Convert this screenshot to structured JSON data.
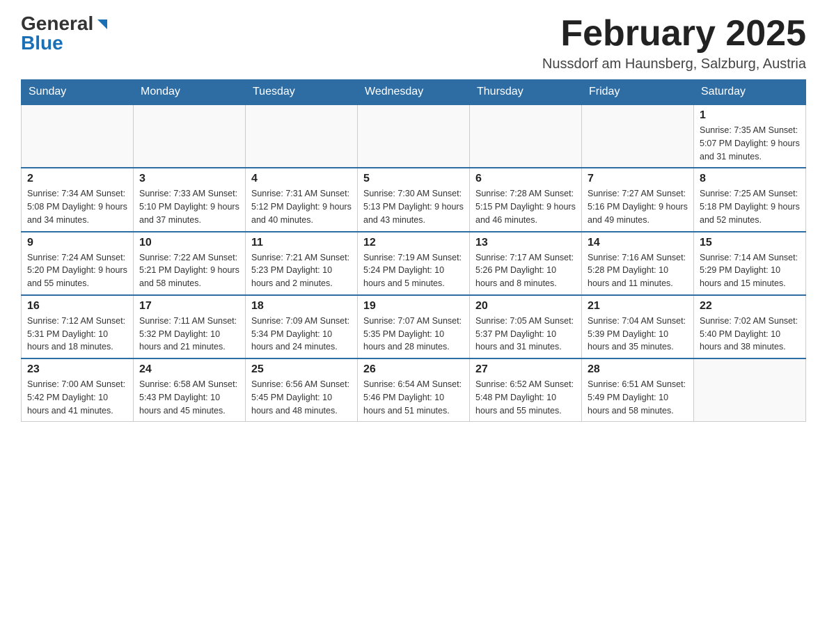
{
  "header": {
    "logo": {
      "general": "General",
      "arrow_symbol": "▶",
      "blue": "Blue"
    },
    "title": "February 2025",
    "location": "Nussdorf am Haunsberg, Salzburg, Austria"
  },
  "days_of_week": [
    "Sunday",
    "Monday",
    "Tuesday",
    "Wednesday",
    "Thursday",
    "Friday",
    "Saturday"
  ],
  "weeks": [
    {
      "days": [
        {
          "number": "",
          "info": ""
        },
        {
          "number": "",
          "info": ""
        },
        {
          "number": "",
          "info": ""
        },
        {
          "number": "",
          "info": ""
        },
        {
          "number": "",
          "info": ""
        },
        {
          "number": "",
          "info": ""
        },
        {
          "number": "1",
          "info": "Sunrise: 7:35 AM\nSunset: 5:07 PM\nDaylight: 9 hours\nand 31 minutes."
        }
      ]
    },
    {
      "days": [
        {
          "number": "2",
          "info": "Sunrise: 7:34 AM\nSunset: 5:08 PM\nDaylight: 9 hours\nand 34 minutes."
        },
        {
          "number": "3",
          "info": "Sunrise: 7:33 AM\nSunset: 5:10 PM\nDaylight: 9 hours\nand 37 minutes."
        },
        {
          "number": "4",
          "info": "Sunrise: 7:31 AM\nSunset: 5:12 PM\nDaylight: 9 hours\nand 40 minutes."
        },
        {
          "number": "5",
          "info": "Sunrise: 7:30 AM\nSunset: 5:13 PM\nDaylight: 9 hours\nand 43 minutes."
        },
        {
          "number": "6",
          "info": "Sunrise: 7:28 AM\nSunset: 5:15 PM\nDaylight: 9 hours\nand 46 minutes."
        },
        {
          "number": "7",
          "info": "Sunrise: 7:27 AM\nSunset: 5:16 PM\nDaylight: 9 hours\nand 49 minutes."
        },
        {
          "number": "8",
          "info": "Sunrise: 7:25 AM\nSunset: 5:18 PM\nDaylight: 9 hours\nand 52 minutes."
        }
      ]
    },
    {
      "days": [
        {
          "number": "9",
          "info": "Sunrise: 7:24 AM\nSunset: 5:20 PM\nDaylight: 9 hours\nand 55 minutes."
        },
        {
          "number": "10",
          "info": "Sunrise: 7:22 AM\nSunset: 5:21 PM\nDaylight: 9 hours\nand 58 minutes."
        },
        {
          "number": "11",
          "info": "Sunrise: 7:21 AM\nSunset: 5:23 PM\nDaylight: 10 hours\nand 2 minutes."
        },
        {
          "number": "12",
          "info": "Sunrise: 7:19 AM\nSunset: 5:24 PM\nDaylight: 10 hours\nand 5 minutes."
        },
        {
          "number": "13",
          "info": "Sunrise: 7:17 AM\nSunset: 5:26 PM\nDaylight: 10 hours\nand 8 minutes."
        },
        {
          "number": "14",
          "info": "Sunrise: 7:16 AM\nSunset: 5:28 PM\nDaylight: 10 hours\nand 11 minutes."
        },
        {
          "number": "15",
          "info": "Sunrise: 7:14 AM\nSunset: 5:29 PM\nDaylight: 10 hours\nand 15 minutes."
        }
      ]
    },
    {
      "days": [
        {
          "number": "16",
          "info": "Sunrise: 7:12 AM\nSunset: 5:31 PM\nDaylight: 10 hours\nand 18 minutes."
        },
        {
          "number": "17",
          "info": "Sunrise: 7:11 AM\nSunset: 5:32 PM\nDaylight: 10 hours\nand 21 minutes."
        },
        {
          "number": "18",
          "info": "Sunrise: 7:09 AM\nSunset: 5:34 PM\nDaylight: 10 hours\nand 24 minutes."
        },
        {
          "number": "19",
          "info": "Sunrise: 7:07 AM\nSunset: 5:35 PM\nDaylight: 10 hours\nand 28 minutes."
        },
        {
          "number": "20",
          "info": "Sunrise: 7:05 AM\nSunset: 5:37 PM\nDaylight: 10 hours\nand 31 minutes."
        },
        {
          "number": "21",
          "info": "Sunrise: 7:04 AM\nSunset: 5:39 PM\nDaylight: 10 hours\nand 35 minutes."
        },
        {
          "number": "22",
          "info": "Sunrise: 7:02 AM\nSunset: 5:40 PM\nDaylight: 10 hours\nand 38 minutes."
        }
      ]
    },
    {
      "days": [
        {
          "number": "23",
          "info": "Sunrise: 7:00 AM\nSunset: 5:42 PM\nDaylight: 10 hours\nand 41 minutes."
        },
        {
          "number": "24",
          "info": "Sunrise: 6:58 AM\nSunset: 5:43 PM\nDaylight: 10 hours\nand 45 minutes."
        },
        {
          "number": "25",
          "info": "Sunrise: 6:56 AM\nSunset: 5:45 PM\nDaylight: 10 hours\nand 48 minutes."
        },
        {
          "number": "26",
          "info": "Sunrise: 6:54 AM\nSunset: 5:46 PM\nDaylight: 10 hours\nand 51 minutes."
        },
        {
          "number": "27",
          "info": "Sunrise: 6:52 AM\nSunset: 5:48 PM\nDaylight: 10 hours\nand 55 minutes."
        },
        {
          "number": "28",
          "info": "Sunrise: 6:51 AM\nSunset: 5:49 PM\nDaylight: 10 hours\nand 58 minutes."
        },
        {
          "number": "",
          "info": ""
        }
      ]
    }
  ]
}
